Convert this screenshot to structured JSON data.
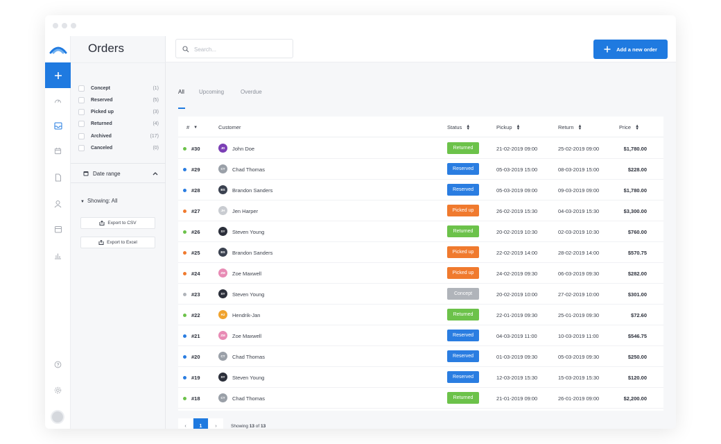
{
  "window": {
    "dots": 3
  },
  "sidebar": {
    "logo": "brand-logo",
    "add_icon": "+",
    "nav_icons": [
      "dashboard-icon",
      "inbox-icon",
      "calendar-icon",
      "document-icon",
      "user-icon",
      "store-icon",
      "chart-icon"
    ],
    "bottom_icons": [
      "help-icon",
      "settings-icon"
    ]
  },
  "filters": {
    "title": "Orders",
    "statuses": [
      {
        "label": "Concept",
        "count": "(1)"
      },
      {
        "label": "Reserved",
        "count": "(5)"
      },
      {
        "label": "Picked up",
        "count": "(3)"
      },
      {
        "label": "Returned",
        "count": "(4)"
      },
      {
        "label": "Archived",
        "count": "(17)"
      },
      {
        "label": "Canceled",
        "count": "(0)"
      }
    ],
    "date_range_label": "Date range",
    "showing_label": "Showing: All",
    "export_csv": "Export to CSV",
    "export_excel": "Export to Excel"
  },
  "search": {
    "placeholder": "Search..."
  },
  "add_button_label": "Add a new order",
  "tabs": [
    {
      "label": "All"
    },
    {
      "label": "Upcoming"
    },
    {
      "label": "Overdue"
    }
  ],
  "table": {
    "headers": {
      "num": "#",
      "customer": "Customer",
      "status": "Status",
      "pickup": "Pickup",
      "return": "Return",
      "price": "Price"
    },
    "rows": [
      {
        "num": "#30",
        "initials": "JD",
        "customer": "John Doe",
        "status": "Returned",
        "pickup": "21-02-2019 09:00",
        "return": "25-02-2019 09:00",
        "price": "$1,780.00",
        "dot": "#6cc24a",
        "avatar": "#7b3fb5"
      },
      {
        "num": "#29",
        "initials": "CT",
        "customer": "Chad Thomas",
        "status": "Reserved",
        "pickup": "05-03-2019 15:00",
        "return": "08-03-2019 15:00",
        "price": "$228.00",
        "dot": "#2a7de1",
        "avatar": "#9aa0a8"
      },
      {
        "num": "#28",
        "initials": "BS",
        "customer": "Brandon Sanders",
        "status": "Reserved",
        "pickup": "05-03-2019 09:00",
        "return": "09-03-2019 09:00",
        "price": "$1,780.00",
        "dot": "#2a7de1",
        "avatar": "#3b4250"
      },
      {
        "num": "#27",
        "initials": "JH",
        "customer": "Jen Harper",
        "status": "Picked up",
        "pickup": "26-02-2019 15:30",
        "return": "04-03-2019 15:30",
        "price": "$3,300.00",
        "dot": "#f07a2e",
        "avatar": "#c9ccd1"
      },
      {
        "num": "#26",
        "initials": "SY",
        "customer": "Steven Young",
        "status": "Returned",
        "pickup": "20-02-2019 10:30",
        "return": "02-03-2019 10:30",
        "price": "$760.00",
        "dot": "#6cc24a",
        "avatar": "#2b2f3a"
      },
      {
        "num": "#25",
        "initials": "BS",
        "customer": "Brandon Sanders",
        "status": "Picked up",
        "pickup": "22-02-2019 14:00",
        "return": "28-02-2019 14:00",
        "price": "$570.75",
        "dot": "#f07a2e",
        "avatar": "#3b4250"
      },
      {
        "num": "#24",
        "initials": "ZM",
        "customer": "Zoe Maxwell",
        "status": "Picked up",
        "pickup": "24-02-2019 09:30",
        "return": "06-03-2019 09:30",
        "price": "$282.00",
        "dot": "#f07a2e",
        "avatar": "#e88bb5"
      },
      {
        "num": "#23",
        "initials": "SY",
        "customer": "Steven Young",
        "status": "Concept",
        "pickup": "20-02-2019 10:00",
        "return": "27-02-2019 10:00",
        "price": "$301.00",
        "dot": "#b0b4ba",
        "avatar": "#2b2f3a"
      },
      {
        "num": "#22",
        "initials": "HJ",
        "customer": "Hendrik-Jan",
        "status": "Returned",
        "pickup": "22-01-2019 09:30",
        "return": "25-01-2019 09:30",
        "price": "$72.60",
        "dot": "#6cc24a",
        "avatar": "#f0a32e"
      },
      {
        "num": "#21",
        "initials": "ZM",
        "customer": "Zoe Maxwell",
        "status": "Reserved",
        "pickup": "04-03-2019 11:00",
        "return": "10-03-2019 11:00",
        "price": "$546.75",
        "dot": "#2a7de1",
        "avatar": "#e88bb5"
      },
      {
        "num": "#20",
        "initials": "CT",
        "customer": "Chad Thomas",
        "status": "Reserved",
        "pickup": "01-03-2019 09:30",
        "return": "05-03-2019 09:30",
        "price": "$250.00",
        "dot": "#2a7de1",
        "avatar": "#9aa0a8"
      },
      {
        "num": "#19",
        "initials": "SY",
        "customer": "Steven Young",
        "status": "Reserved",
        "pickup": "12-03-2019 15:30",
        "return": "15-03-2019 15:30",
        "price": "$120.00",
        "dot": "#2a7de1",
        "avatar": "#2b2f3a"
      },
      {
        "num": "#18",
        "initials": "CT",
        "customer": "Chad Thomas",
        "status": "Returned",
        "pickup": "21-01-2019 09:00",
        "return": "26-01-2019 09:00",
        "price": "$2,200.00",
        "dot": "#6cc24a",
        "avatar": "#9aa0a8"
      }
    ]
  },
  "status_colors": {
    "Returned": "#6cc24a",
    "Reserved": "#2a7de1",
    "Picked up": "#f07a2e",
    "Concept": "#b0b4ba"
  },
  "pagination": {
    "prev": "‹",
    "current": "1",
    "next": "›",
    "info_prefix": "Showing",
    "shown": "13",
    "of": "of",
    "total": "13"
  }
}
